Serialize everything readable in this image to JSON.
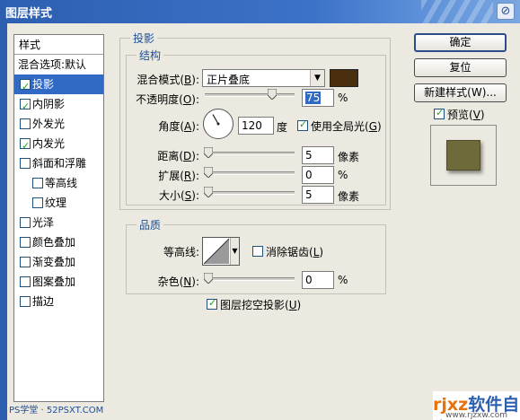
{
  "window": {
    "title": "图层样式",
    "close_glyph": "⊘"
  },
  "style_list": {
    "header": "样式",
    "items": [
      {
        "label": "混合选项:默认",
        "has_checkbox": false,
        "checked": false,
        "indent": false,
        "selected": false
      },
      {
        "label": "投影",
        "has_checkbox": true,
        "checked": true,
        "indent": false,
        "selected": true
      },
      {
        "label": "内阴影",
        "has_checkbox": true,
        "checked": true,
        "indent": false,
        "selected": false
      },
      {
        "label": "外发光",
        "has_checkbox": true,
        "checked": false,
        "indent": false,
        "selected": false
      },
      {
        "label": "内发光",
        "has_checkbox": true,
        "checked": true,
        "indent": false,
        "selected": false
      },
      {
        "label": "斜面和浮雕",
        "has_checkbox": true,
        "checked": false,
        "indent": false,
        "selected": false
      },
      {
        "label": "等高线",
        "has_checkbox": true,
        "checked": false,
        "indent": true,
        "selected": false
      },
      {
        "label": "纹理",
        "has_checkbox": true,
        "checked": false,
        "indent": true,
        "selected": false
      },
      {
        "label": "光泽",
        "has_checkbox": true,
        "checked": false,
        "indent": false,
        "selected": false
      },
      {
        "label": "颜色叠加",
        "has_checkbox": true,
        "checked": false,
        "indent": false,
        "selected": false
      },
      {
        "label": "渐变叠加",
        "has_checkbox": true,
        "checked": false,
        "indent": false,
        "selected": false
      },
      {
        "label": "图案叠加",
        "has_checkbox": true,
        "checked": false,
        "indent": false,
        "selected": false
      },
      {
        "label": "描边",
        "has_checkbox": true,
        "checked": false,
        "indent": false,
        "selected": false
      }
    ]
  },
  "drop_shadow": {
    "title": "投影",
    "structure": {
      "title": "结构",
      "blend_mode": {
        "label": "混合模式",
        "mnemonic": "B",
        "value": "正片叠底",
        "color": "#4a2e10"
      },
      "opacity": {
        "label": "不透明度",
        "mnemonic": "O",
        "value": "75",
        "unit": "%",
        "slider_fraction": 0.75
      },
      "angle": {
        "label": "角度",
        "mnemonic": "A",
        "value": "120",
        "unit": "度",
        "degrees": 120
      },
      "use_global_light": {
        "label": "使用全局光",
        "mnemonic": "G",
        "checked": true
      },
      "distance": {
        "label": "距离",
        "mnemonic": "D",
        "value": "5",
        "unit": "像素",
        "slider_fraction": 0.0
      },
      "spread": {
        "label": "扩展",
        "mnemonic": "R",
        "value": "0",
        "unit": "%",
        "slider_fraction": 0.0
      },
      "size": {
        "label": "大小",
        "mnemonic": "S",
        "value": "5",
        "unit": "像素",
        "slider_fraction": 0.0
      }
    },
    "quality": {
      "title": "品质",
      "contour": {
        "label": "等高线"
      },
      "anti_aliased": {
        "label": "消除锯齿",
        "mnemonic": "L",
        "checked": false
      },
      "noise": {
        "label": "杂色",
        "mnemonic": "N",
        "value": "0",
        "unit": "%",
        "slider_fraction": 0.0
      }
    },
    "knockout": {
      "label": "图层挖空投影",
      "mnemonic": "U",
      "checked": true
    }
  },
  "buttons": {
    "ok": "确定",
    "reset": "复位",
    "new_style": "新建样式(W)...",
    "preview": {
      "label": "预览",
      "mnemonic": "V",
      "checked": true
    }
  },
  "preview_color": "#6e6a3a",
  "watermarks": {
    "left": "PS学堂 · 52PSXT.COM",
    "right_logo_prefix": "rjxz",
    "right_logo_main": "软件自学网",
    "right_url": "www.rjzxw.com"
  }
}
